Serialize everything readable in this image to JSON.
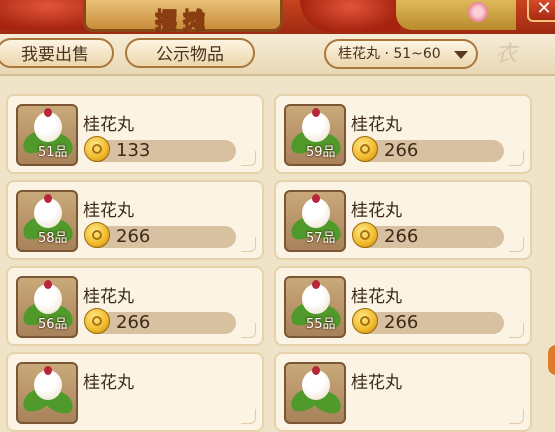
{
  "header": {
    "title": "摆摊",
    "close_label": "✕"
  },
  "tabs": {
    "sell_label": "我要出售",
    "public_label": "公示物品"
  },
  "filter": {
    "label": "桂花丸 · 51~60"
  },
  "watermark": "衣",
  "items": [
    {
      "name": "桂花丸",
      "level": "51品",
      "price": "133"
    },
    {
      "name": "桂花丸",
      "level": "59品",
      "price": "266"
    },
    {
      "name": "桂花丸",
      "level": "58品",
      "price": "266"
    },
    {
      "name": "桂花丸",
      "level": "57品",
      "price": "266"
    },
    {
      "name": "桂花丸",
      "level": "56品",
      "price": "266"
    },
    {
      "name": "桂花丸",
      "level": "55品",
      "price": "266"
    },
    {
      "name": "桂花丸",
      "level": "",
      "price": ""
    },
    {
      "name": "桂花丸",
      "level": "",
      "price": ""
    }
  ],
  "icons": {
    "item_icon": "osmanthus-rice-ball-icon",
    "currency_icon": "gold-coin-icon",
    "dropdown_icon": "caret-down-icon",
    "close_icon": "close-icon"
  },
  "colors": {
    "background": "#efe3c8",
    "banner_red": "#b3341a",
    "card_bg": "#fbf3e3",
    "text": "#3e2a1a"
  }
}
